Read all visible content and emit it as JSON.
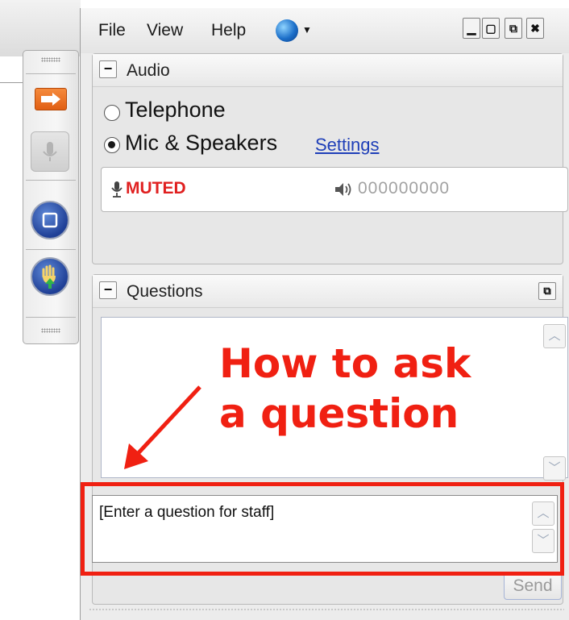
{
  "menu": {
    "file": "File",
    "view": "View",
    "help": "Help",
    "globe_icon": "globe-icon"
  },
  "window_controls": [
    "minimize",
    "maximize",
    "restore",
    "close"
  ],
  "toolbar": {
    "buttons": [
      "arrow-icon",
      "microphone-icon",
      "share-screen-icon",
      "raise-hand-icon"
    ]
  },
  "audio": {
    "title": "Audio",
    "options": [
      {
        "label": "Telephone",
        "selected": false
      },
      {
        "label": "Mic & Speakers",
        "selected": true
      }
    ],
    "settings_link": "Settings",
    "status": "MUTED",
    "level": "000000000"
  },
  "questions": {
    "title": "Questions",
    "input_placeholder": "[Enter a question for staff]",
    "send_label": "Send"
  },
  "annotation": {
    "line1": "How to ask",
    "line2": "a question",
    "color": "#f02012"
  },
  "colors": {
    "muted": "#e02020",
    "link": "#1f3fb8",
    "accent_orange": "#e15f13",
    "button_blue": "#1f3f96"
  }
}
